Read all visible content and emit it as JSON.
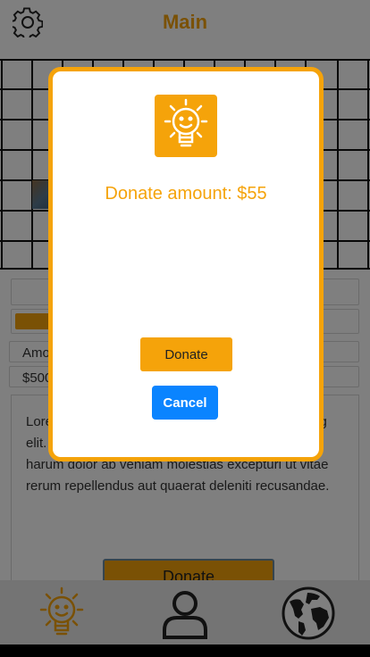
{
  "header": {
    "title": "Main",
    "settings_icon": "gear-icon"
  },
  "background": {
    "row3_text": "Amo",
    "row4_text": "$500",
    "card_text": "Lorem ipsum dolor sit amet consectetur adipisicing elit. Voluptatum, atque. Eos quos soluta quisquam harum dolor ab veniam molestias excepturi ut vitae rerum repellendus aut quaerat deleniti recusandae.",
    "donate_button_label": "Donate"
  },
  "bottom_nav": {
    "items": [
      {
        "icon": "lightbulb-icon"
      },
      {
        "icon": "user-icon"
      },
      {
        "icon": "globe-icon"
      }
    ]
  },
  "modal": {
    "logo_icon": "lightbulb-icon",
    "amount_text": "Donate amount: $55",
    "donate_label": "Donate",
    "cancel_label": "Cancel"
  },
  "colors": {
    "accent": "#f5a30a",
    "cancel": "#0a84ff"
  }
}
